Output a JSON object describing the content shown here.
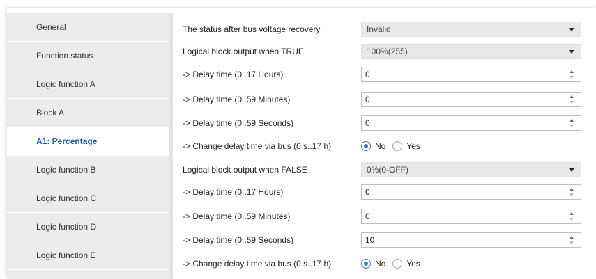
{
  "sidebar": {
    "items": [
      {
        "label": "General"
      },
      {
        "label": "Function status"
      },
      {
        "label": "Logic function A"
      },
      {
        "label": "Block A"
      },
      {
        "label": "A1: Percentage",
        "active": true
      },
      {
        "label": "Logic function B"
      },
      {
        "label": "Logic function C"
      },
      {
        "label": "Logic function D"
      },
      {
        "label": "Logic function E"
      }
    ]
  },
  "params": {
    "rows": [
      {
        "label": "The status after bus voltage recovery",
        "type": "select",
        "value": "Invalid"
      },
      {
        "label": "Logical block output when TRUE",
        "type": "select",
        "value": "100%(255)"
      },
      {
        "label": "-> Delay time (0..17 Hours)",
        "type": "spin",
        "value": "0"
      },
      {
        "label": "-> Delay time (0..59 Minutes)",
        "type": "spin",
        "value": "0"
      },
      {
        "label": "-> Delay time (0..59 Seconds)",
        "type": "spin",
        "value": "0"
      },
      {
        "label": "-> Change delay time via bus (0 s..17 h)",
        "type": "radio",
        "options": [
          "No",
          "Yes"
        ],
        "selected": "No"
      },
      {
        "label": "Logical block output when FALSE",
        "type": "select",
        "value": "0%(0-OFF)"
      },
      {
        "label": "-> Delay time (0..17 Hours)",
        "type": "spin",
        "value": "0"
      },
      {
        "label": "-> Delay time (0..59 Minutes)",
        "type": "spin",
        "value": "0"
      },
      {
        "label": "-> Delay time (0..59 Seconds)",
        "type": "spin",
        "value": "10"
      },
      {
        "label": "-> Change delay time via bus (0 s..17 h)",
        "type": "radio",
        "options": [
          "No",
          "Yes"
        ],
        "selected": "No"
      }
    ]
  },
  "colors": {
    "accent": "#3b78c3",
    "active_nav_text": "#1a5fa8",
    "sidebar_bg": "#ececec",
    "select_bg": "#e8e8e8"
  }
}
